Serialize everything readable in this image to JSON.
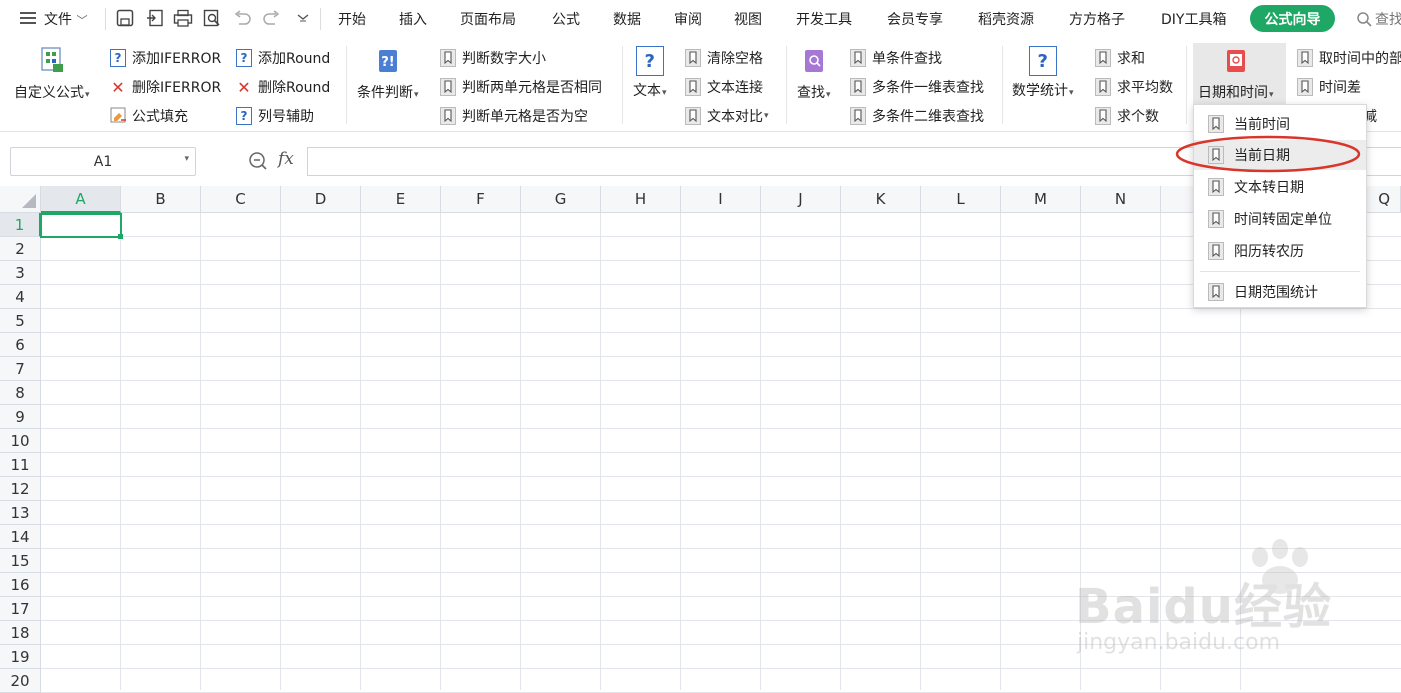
{
  "toolbar": {
    "file_label": "文件",
    "tabs": [
      "开始",
      "插入",
      "页面布局",
      "公式",
      "数据",
      "审阅",
      "视图",
      "开发工具",
      "会员专享",
      "稻壳资源",
      "方方格子",
      "DIY工具箱"
    ],
    "active_tab": "公式向导",
    "search_label": "查找"
  },
  "ribbon": {
    "custom_formula": "自定义公式",
    "add_iferror": "添加IFERROR",
    "del_iferror": "删除IFERROR",
    "formula_fill": "公式填充",
    "add_round": "添加Round",
    "del_round": "删除Round",
    "col_assist": "列号辅助",
    "condition": "条件判断",
    "cmp_size": "判断数字大小",
    "cmp_same": "判断两单元格是否相同",
    "cmp_empty": "判断单元格是否为空",
    "text": "文本",
    "clear_space": "清除空格",
    "text_concat": "文本连接",
    "text_compare": "文本对比",
    "lookup": "查找",
    "single_lookup": "单条件查找",
    "multi_1d": "多条件一维表查找",
    "multi_2d": "多条件二维表查找",
    "stats": "数学统计",
    "sum": "求和",
    "avg": "求平均数",
    "count": "求个数",
    "datetime": "日期和时间",
    "take_part": "取时间中的部",
    "time_diff": "时间差",
    "minus_frag": "减"
  },
  "formula_bar": {
    "name_box": "A1",
    "fx": "fx"
  },
  "grid": {
    "columns": [
      "A",
      "B",
      "C",
      "D",
      "E",
      "F",
      "G",
      "H",
      "I",
      "J",
      "K",
      "L",
      "M",
      "N"
    ],
    "col_o_frag": "Q",
    "rows": [
      "1",
      "2",
      "3",
      "4",
      "5",
      "6",
      "7",
      "8",
      "9",
      "10",
      "11",
      "12",
      "13",
      "14",
      "15",
      "16",
      "17",
      "18",
      "19",
      "20"
    ],
    "selected_cell": "A1"
  },
  "dropdown": {
    "items": [
      "当前时间",
      "当前日期",
      "文本转日期",
      "时间转固定单位",
      "阳历转农历",
      "日期范围统计"
    ],
    "highlighted": "当前日期"
  },
  "watermark": {
    "brand": "Baidu经验",
    "url": "jingyan.baidu.com"
  },
  "colors": {
    "accent_green": "#1fa765",
    "annotation_red": "#d9352b"
  }
}
